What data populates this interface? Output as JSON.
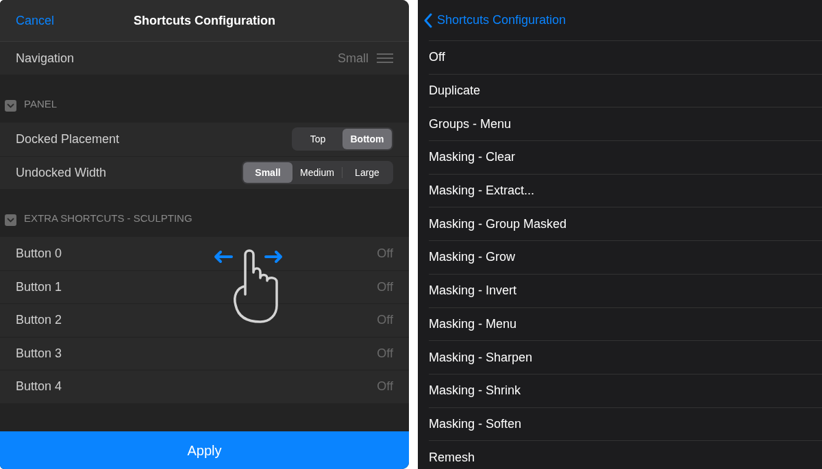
{
  "left_panel": {
    "cancel": "Cancel",
    "title": "Shortcuts Configuration",
    "navigation": {
      "label": "Navigation",
      "value": "Small"
    },
    "sections": [
      {
        "title": "PANEL",
        "expanded": true,
        "rows": [
          {
            "kind": "segmented",
            "label": "Docked Placement",
            "options": [
              {
                "label": "Top",
                "selected": false
              },
              {
                "label": "Bottom",
                "selected": true
              }
            ]
          },
          {
            "kind": "segmented",
            "label": "Undocked Width",
            "options": [
              {
                "label": "Small",
                "selected": true
              },
              {
                "label": "Medium",
                "selected": false
              },
              {
                "label": "Large",
                "selected": false
              }
            ]
          }
        ]
      },
      {
        "title": "EXTRA SHORTCUTS - SCULPTING",
        "expanded": true,
        "rows": [
          {
            "kind": "value",
            "label": "Button 0",
            "value": "Off"
          },
          {
            "kind": "value",
            "label": "Button 1",
            "value": "Off"
          },
          {
            "kind": "value",
            "label": "Button 2",
            "value": "Off"
          },
          {
            "kind": "value",
            "label": "Button 3",
            "value": "Off"
          },
          {
            "kind": "value",
            "label": "Button 4",
            "value": "Off"
          }
        ]
      }
    ],
    "apply": "Apply"
  },
  "right_panel": {
    "back": "Shortcuts Configuration",
    "items": [
      "Off",
      "Duplicate",
      "Groups - Menu",
      "Masking - Clear",
      "Masking - Extract...",
      "Masking - Group Masked",
      "Masking - Grow",
      "Masking - Invert",
      "Masking - Menu",
      "Masking - Sharpen",
      "Masking - Shrink",
      "Masking - Soften",
      "Remesh"
    ]
  }
}
